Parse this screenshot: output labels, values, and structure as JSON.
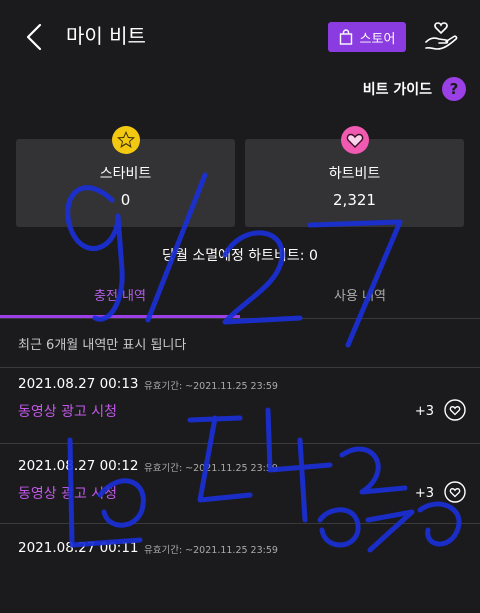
{
  "header": {
    "title": "마이 비트",
    "store_label": "스토어"
  },
  "guide": {
    "label": "비트 가이드",
    "icon_text": "?"
  },
  "cards": [
    {
      "label": "스타비트",
      "value": "0",
      "icon": "star-icon",
      "color": "#f2c811"
    },
    {
      "label": "하트비트",
      "value": "2,321",
      "icon": "heart-icon",
      "color": "#f05ab0"
    }
  ],
  "notice": "당월 소멸예정 하트비트: 0",
  "tabs": [
    {
      "label": "충전 내역",
      "active": true
    },
    {
      "label": "사용 내역",
      "active": false
    }
  ],
  "info_text": "최근 6개월 내역만 표시 됩니다",
  "history": [
    {
      "date": "2021.08.27 00:13",
      "valid": "유효기간: ~2021.11.25 23:59",
      "name": "동영상 광고 시청",
      "amount": "+3"
    },
    {
      "date": "2021.08.27 00:12",
      "valid": "유효기간: ~2021.11.25 23:59",
      "name": "동영상 광고 시청",
      "amount": "+3"
    },
    {
      "date": "2021.08.27 00:11",
      "valid": "유효기간: ~2021.11.25 23:59",
      "name": "",
      "amount": ""
    }
  ],
  "colors": {
    "accent": "#9b3fe6",
    "background": "#1b1b1d",
    "card": "#333336",
    "scribble": "#1a2fd6"
  }
}
